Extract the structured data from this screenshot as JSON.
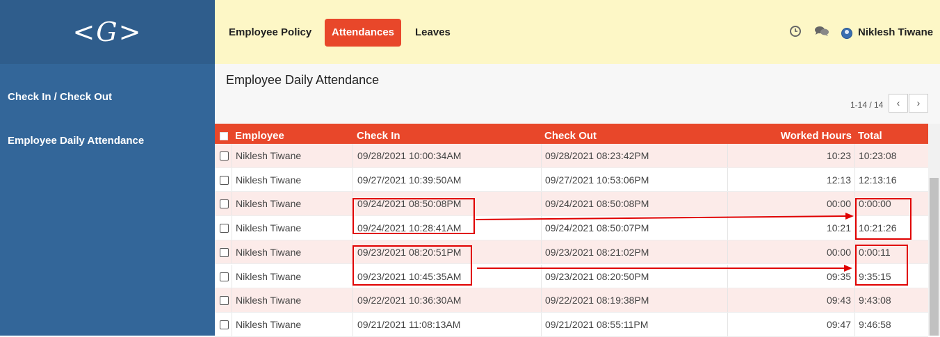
{
  "brand": {
    "logo_text": "<G>"
  },
  "sidebar": {
    "items": [
      {
        "label": "Check In / Check Out"
      },
      {
        "label": "Employee Daily Attendance"
      }
    ]
  },
  "nav": {
    "items": [
      {
        "label": "Employee Policy"
      },
      {
        "label": "Attendances",
        "active": true
      },
      {
        "label": "Leaves"
      }
    ],
    "icons": [
      "clock-icon",
      "chat-icon"
    ],
    "user_name": "Niklesh Tiwane"
  },
  "page": {
    "title": "Employee Daily Attendance",
    "pager": "1-14 / 14",
    "pager_prev": "‹",
    "pager_next": "›"
  },
  "table": {
    "headers": {
      "employee": "Employee",
      "check_in": "Check In",
      "check_out": "Check Out",
      "worked_hours": "Worked Hours",
      "total": "Total"
    },
    "rows": [
      {
        "employee": "Niklesh Tiwane",
        "check_in": "09/28/2021 10:00:34AM",
        "check_out": "09/28/2021 08:23:42PM",
        "worked_hours": "10:23",
        "total": "10:23:08"
      },
      {
        "employee": "Niklesh Tiwane",
        "check_in": "09/27/2021 10:39:50AM",
        "check_out": "09/27/2021 10:53:06PM",
        "worked_hours": "12:13",
        "total": "12:13:16"
      },
      {
        "employee": "Niklesh Tiwane",
        "check_in": "09/24/2021 08:50:08PM",
        "check_out": "09/24/2021 08:50:08PM",
        "worked_hours": "00:00",
        "total": "0:00:00"
      },
      {
        "employee": "Niklesh Tiwane",
        "check_in": "09/24/2021 10:28:41AM",
        "check_out": "09/24/2021 08:50:07PM",
        "worked_hours": "10:21",
        "total": "10:21:26"
      },
      {
        "employee": "Niklesh Tiwane",
        "check_in": "09/23/2021 08:20:51PM",
        "check_out": "09/23/2021 08:21:02PM",
        "worked_hours": "00:00",
        "total": "0:00:11"
      },
      {
        "employee": "Niklesh Tiwane",
        "check_in": "09/23/2021 10:45:35AM",
        "check_out": "09/23/2021 08:20:50PM",
        "worked_hours": "09:35",
        "total": "9:35:15"
      },
      {
        "employee": "Niklesh Tiwane",
        "check_in": "09/22/2021 10:36:30AM",
        "check_out": "09/22/2021 08:19:38PM",
        "worked_hours": "09:43",
        "total": "9:43:08"
      },
      {
        "employee": "Niklesh Tiwane",
        "check_in": "09/21/2021 11:08:13AM",
        "check_out": "09/21/2021 08:55:11PM",
        "worked_hours": "09:47",
        "total": "9:46:58"
      }
    ]
  },
  "colors": {
    "accent": "#e8472a",
    "sidebar": "#336699",
    "topbar": "#fdf7c6",
    "annotation": "#e00000"
  }
}
